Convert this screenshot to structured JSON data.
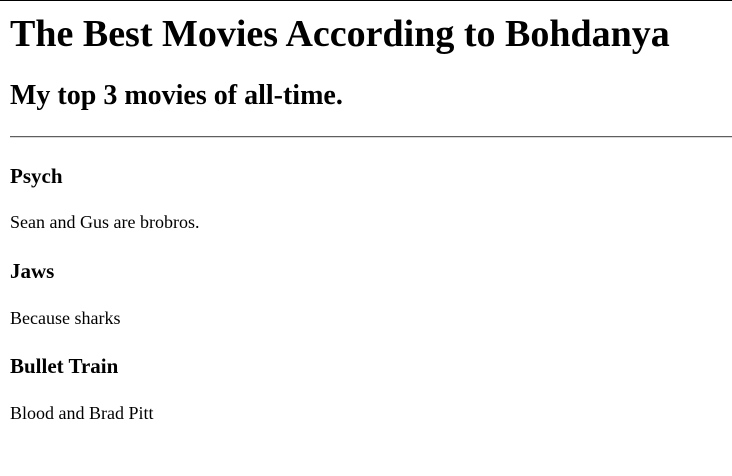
{
  "page": {
    "title": "The Best Movies According to Bohdanya",
    "subtitle": "My top 3 movies of all-time."
  },
  "movies": [
    {
      "title": "Psych",
      "description": "Sean and Gus are brobros."
    },
    {
      "title": "Jaws",
      "description": "Because sharks"
    },
    {
      "title": "Bullet Train",
      "description": "Blood and Brad Pitt"
    }
  ]
}
